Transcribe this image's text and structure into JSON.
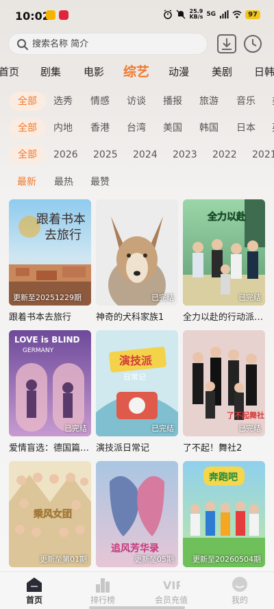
{
  "status_bar": {
    "time": "10:02",
    "net_speed_value": "25.9",
    "net_speed_unit": "KB/s",
    "signal_label": "5G",
    "battery": "97"
  },
  "search": {
    "placeholder": "搜索名称 简介"
  },
  "category_tabs": [
    {
      "label": "首页",
      "active": false
    },
    {
      "label": "剧集",
      "active": false
    },
    {
      "label": "电影",
      "active": false
    },
    {
      "label": "综艺",
      "active": true
    },
    {
      "label": "动漫",
      "active": false
    },
    {
      "label": "美剧",
      "active": false
    },
    {
      "label": "日韩",
      "active": false
    }
  ],
  "filters": {
    "type": [
      "全部",
      "选秀",
      "情感",
      "访谈",
      "播报",
      "旅游",
      "音乐",
      "美"
    ],
    "region": [
      "全部",
      "内地",
      "香港",
      "台湾",
      "美国",
      "韩国",
      "日本",
      "英"
    ],
    "year": [
      "全部",
      "2026",
      "2025",
      "2024",
      "2023",
      "2022",
      "2021"
    ],
    "sort": [
      "最新",
      "最热",
      "最赞"
    ]
  },
  "shows": [
    {
      "title": "跟着书本去旅行",
      "badge": "更新至20251229期"
    },
    {
      "title": "神奇的犬科家族1",
      "badge": "已完结"
    },
    {
      "title": "全力以赴的行动派第…",
      "badge": "已完结"
    },
    {
      "title": "爱情盲选：德国篇第…",
      "badge": "已完结"
    },
    {
      "title": "演技派日常记",
      "badge": "已完结"
    },
    {
      "title": "了不起！舞社2",
      "badge": "已完结"
    },
    {
      "title": "",
      "badge": "更新至第01期"
    },
    {
      "title": "",
      "badge": "更新至05期"
    },
    {
      "title": "",
      "badge": "更新至20260504期"
    }
  ],
  "poster_text": {
    "p1_line1": "跟着书本",
    "p1_line2": "去旅行",
    "p3_logo": "全力以赴",
    "p4_line1": "LOVE is BLIND",
    "p4_line2": "GERMANY",
    "p5_logo": "演技派",
    "p5_sub": "日常记",
    "p6_logo": "了不起舞社",
    "p7_logo": "乘风女团",
    "p8_logo": "追风芳华录",
    "p9_logo": "奔跑吧"
  },
  "bottom_nav": [
    {
      "label": "首页",
      "icon": "home-icon",
      "active": true
    },
    {
      "label": "排行榜",
      "icon": "ranking-icon",
      "active": false
    },
    {
      "label": "会员充值",
      "icon": "vip-icon",
      "active": false
    },
    {
      "label": "我的",
      "icon": "profile-icon",
      "active": false
    }
  ],
  "vip_icon_text": "VIP",
  "colors": {
    "accent": "#f2782b",
    "chip_bg": "#fbece2"
  }
}
